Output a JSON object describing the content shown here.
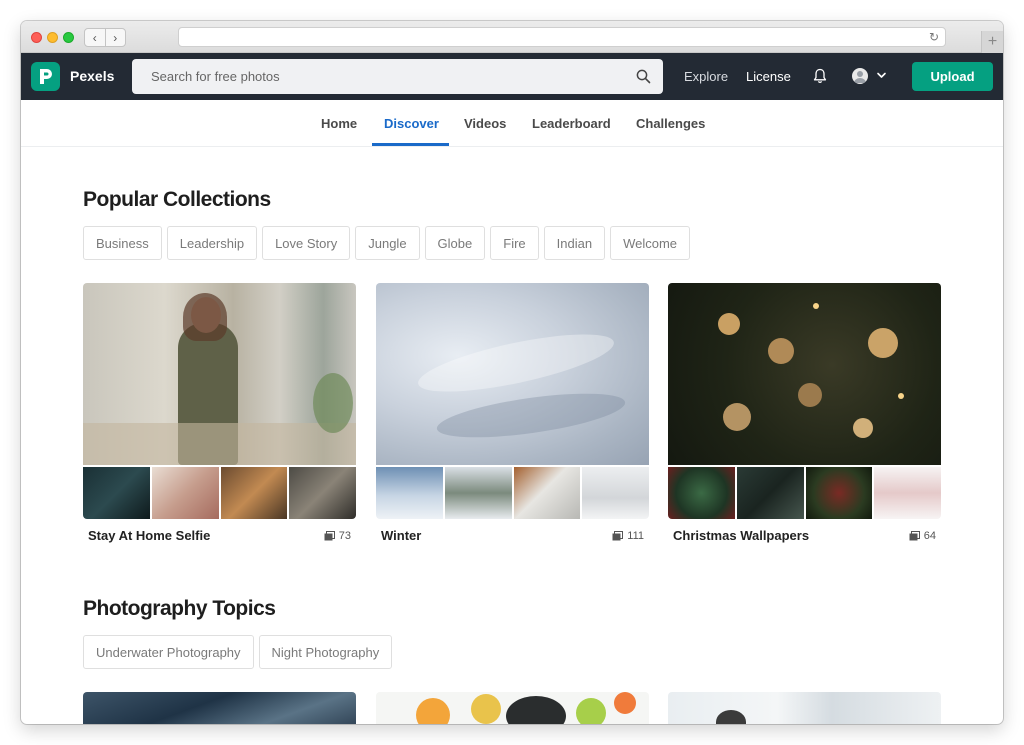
{
  "header": {
    "brand": "Pexels",
    "search_placeholder": "Search for free photos",
    "explore": "Explore",
    "license": "License",
    "upload": "Upload"
  },
  "subnav": {
    "tabs": [
      "Home",
      "Discover",
      "Videos",
      "Leaderboard",
      "Challenges"
    ],
    "active": "Discover"
  },
  "popular": {
    "title": "Popular Collections",
    "tags": [
      "Business",
      "Leadership",
      "Love Story",
      "Jungle",
      "Globe",
      "Fire",
      "Indian",
      "Welcome"
    ],
    "collections": [
      {
        "name": "Stay At Home Selfie",
        "count": "73"
      },
      {
        "name": "Winter",
        "count": "111"
      },
      {
        "name": "Christmas Wallpapers",
        "count": "64"
      }
    ]
  },
  "topics": {
    "title": "Photography Topics",
    "tags": [
      "Underwater Photography",
      "Night Photography"
    ]
  },
  "colors": {
    "accent": "#05a081",
    "header_bg": "#232a34",
    "active_tab": "#1a6ac9"
  }
}
